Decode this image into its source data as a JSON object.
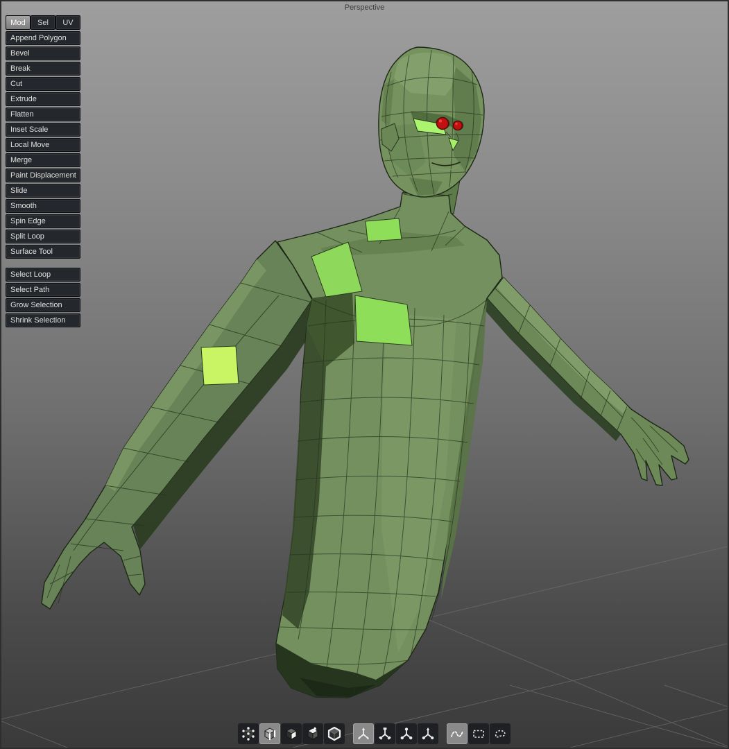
{
  "viewport": {
    "label": "Perspective"
  },
  "tool_panel": {
    "tabs": [
      {
        "label": "Mod",
        "selected": true
      },
      {
        "label": "Sel",
        "selected": false
      },
      {
        "label": "UV",
        "selected": false
      }
    ],
    "tools": [
      "Append Polygon",
      "Bevel",
      "Break",
      "Cut",
      "Extrude",
      "Flatten",
      "Inset Scale",
      "Local Move",
      "Merge",
      "Paint Displacement",
      "Slide",
      "Smooth",
      "Spin Edge",
      "Split Loop",
      "Surface Tool"
    ],
    "selection_tools": [
      "Select Loop",
      "Select Path",
      "Grow Selection",
      "Shrink Selection"
    ]
  },
  "bottom_toolbar": {
    "groups": [
      {
        "name": "component-modes",
        "items": [
          {
            "icon": "vertex-mode",
            "selected": false
          },
          {
            "icon": "edge-mode",
            "selected": true
          },
          {
            "icon": "face-mode",
            "selected": false
          },
          {
            "icon": "multi-mode",
            "selected": false
          },
          {
            "icon": "object-mode",
            "selected": false
          }
        ]
      },
      {
        "name": "manipulators",
        "items": [
          {
            "icon": "manipulator-move",
            "selected": true
          },
          {
            "icon": "manipulator-rotate",
            "selected": false
          },
          {
            "icon": "manipulator-scale",
            "selected": false
          },
          {
            "icon": "manipulator-universal",
            "selected": false
          }
        ]
      },
      {
        "name": "selection-styles",
        "items": [
          {
            "icon": "paint-select",
            "selected": true
          },
          {
            "icon": "marquee-select",
            "selected": false
          },
          {
            "icon": "lasso-select",
            "selected": false
          }
        ]
      }
    ]
  },
  "scene": {
    "subject": "low-poly humanoid bust",
    "colors": {
      "background_top": "#9e9e9e",
      "background_bottom": "#3a3a3a",
      "model_base_green": "#74905e",
      "model_shadow_green": "#2c3e23",
      "highlight_face_green": "#8ede5a",
      "highlight_arm_yellow_green": "#c9f463",
      "eye_red": "#c21010",
      "wireframe": "#26331e",
      "grid_line": "#717171",
      "panel_button_bg": "#24272b",
      "selected_tab_bg": "#8a8a8a"
    }
  }
}
